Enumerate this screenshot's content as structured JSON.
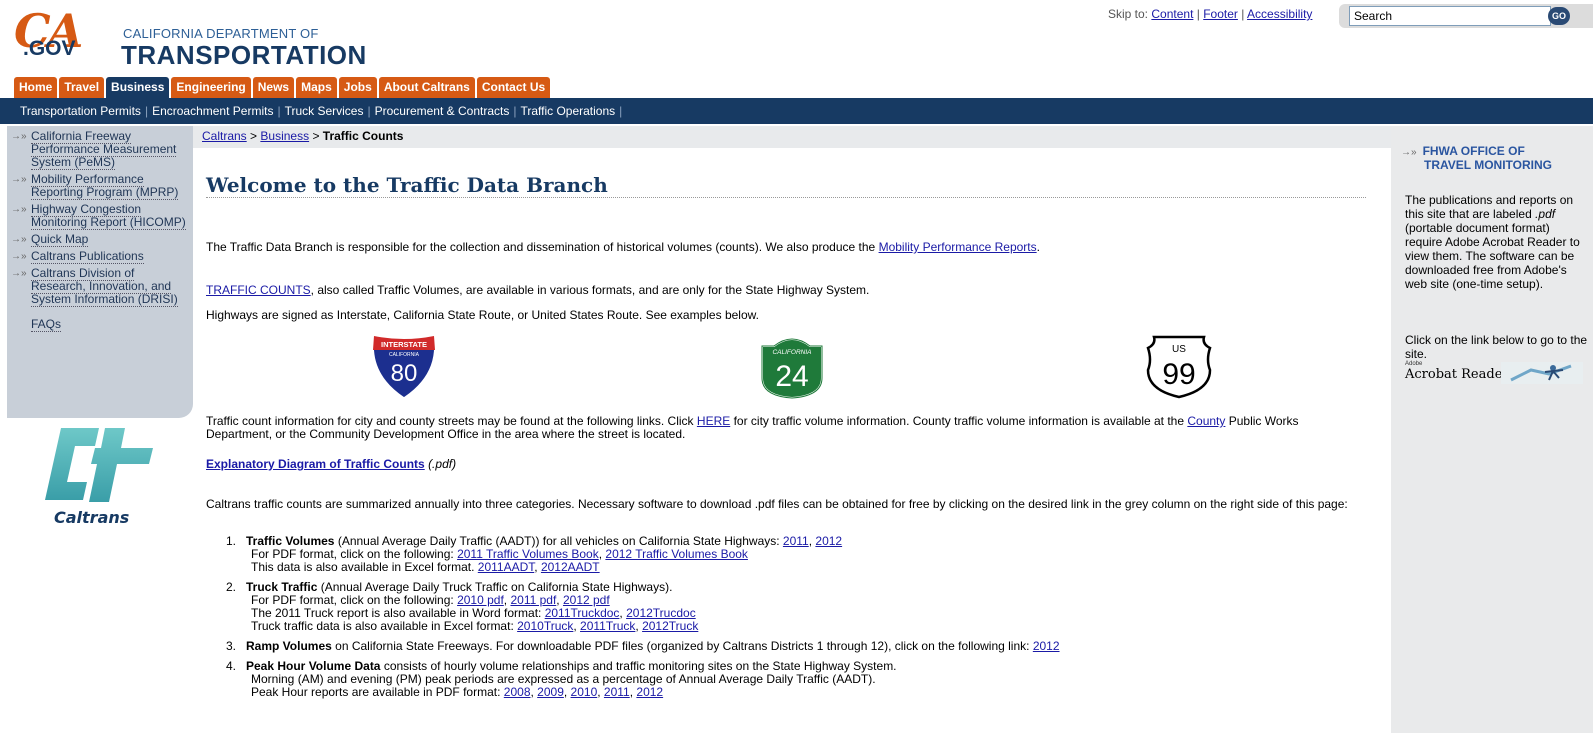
{
  "header": {
    "logo_ca": "CA",
    "logo_gov": ".GOV",
    "logo_dept_sub": "CALIFORNIA DEPARTMENT OF",
    "logo_dept_main": "TRANSPORTATION",
    "skip_to_label": "Skip to:",
    "skip_links": [
      "Content",
      "Footer",
      "Accessibility"
    ],
    "search_value": "Search",
    "search_go_label": "GO"
  },
  "main_nav": {
    "tabs": [
      "Home",
      "Travel",
      "Business",
      "Engineering",
      "News",
      "Maps",
      "Jobs",
      "About Caltrans",
      "Contact Us"
    ],
    "active": "Business",
    "colors": {
      "tab": "#d65a14",
      "active_tab": "#173a63"
    }
  },
  "sub_nav": [
    "Transportation Permits",
    "Encroachment Permits",
    "Truck Services",
    "Procurement & Contracts",
    "Traffic Operations"
  ],
  "left_nav": [
    "California Freeway Performance Measurement System (PeMS)",
    "Mobility Performance Reporting Program (MPRP)",
    "Highway Congestion Monitoring Report (HICOMP)",
    "Quick Map",
    "Caltrans Publications",
    "Caltrans Division of Research, Innovation, and System Information (DRISI)",
    "FAQs"
  ],
  "caltrans_logo_word": "Caltrans",
  "breadcrumb": {
    "items": [
      "Caltrans",
      "Business"
    ],
    "separator": ">",
    "current": "Traffic Counts"
  },
  "main": {
    "title": "Welcome to the Traffic Data Branch",
    "p1_text": "The Traffic Data Branch is responsible for the collection and dissemination of historical volumes (counts). We also produce the",
    "p1_link": "Mobility Performance Reports",
    "p2_link": "TRAFFIC COUNTS",
    "p2_text": ", also called Traffic Volumes, are available in various formats, and are only for the State Highway System.",
    "p3_text": "Highways are signed as Interstate, California State Route, or United States Route. See examples below.",
    "shields": {
      "interstate_label": "INTERSTATE",
      "interstate_state": "CALIFORNIA",
      "interstate_number": "80",
      "state_label": "CALIFORNIA",
      "state_number": "24",
      "us_label": "US",
      "us_number": "99"
    },
    "p4_a": "Traffic count information for city and county streets may be found at the following links. Click",
    "p4_link1": "HERE",
    "p4_b": "for city traffic volume information. County traffic volume information is available at the",
    "p4_link2": "County",
    "p4_c": "Public Works Department, or the Community Development Office in the area where the street is located.",
    "diagram_link": "Explanatory Diagram of Traffic Counts",
    "diagram_suffix": "(.pdf)",
    "p5_text": "Caltrans traffic counts are summarized annually into three categories. Necessary software to download .pdf files can be obtained for free by clicking on the desired link in the grey column on the right side of this page:",
    "list": [
      {
        "num": "1.",
        "title": "Traffic Volumes",
        "desc": "(Annual Average Daily Traffic (AADT)) for all vehicles on California State Highways:",
        "links": [
          "2011",
          "2012"
        ],
        "line2": "For PDF format, click on the following:",
        "line2_links": [
          "2011 Traffic Volumes Book",
          "2012 Traffic Volumes Book"
        ],
        "line3": "This data is also available in Excel format.",
        "line3_links": [
          "2011AADT",
          "2012AADT"
        ]
      },
      {
        "num": "2.",
        "title": "Truck Traffic",
        "desc": "(Annual Average Daily Truck Traffic on California State Highways).",
        "line2": "For PDF format, click on the following:",
        "line2_links": [
          "2010 pdf",
          "2011 pdf",
          "2012 pdf"
        ],
        "line3": "The 2011 Truck report is also available in Word format:",
        "line3_links": [
          "2011Truckdoc",
          "2012Trucdoc"
        ],
        "line4": "Truck traffic data is also available in Excel format:",
        "line4_links": [
          "2010Truck",
          "2011Truck",
          "2012Truck"
        ]
      },
      {
        "num": "3.",
        "title": "Ramp Volumes",
        "desc": "on California State Freeways. For downloadable PDF files (organized by Caltrans Districts 1 through 12), click on the following link:",
        "links": [
          "2012"
        ]
      },
      {
        "num": "4.",
        "title": "Peak Hour Volume Data",
        "desc": "consists of hourly volume relationships and traffic monitoring sites on the State Highway System.",
        "line2": "Morning (AM) and evening (PM) peak periods are expressed as a percentage of Annual Average Daily Traffic (AADT).",
        "line3": "Peak Hour reports are available in PDF format:",
        "line3_links": [
          "2008",
          "2009",
          "2010",
          "2011",
          "2012"
        ]
      }
    ]
  },
  "right": {
    "fhwa_line1": "FHWA OFFICE OF",
    "fhwa_line2": "TRAVEL MONITORING",
    "text1_a": "The publications and reports on this site that are labeled",
    "text1_pdf": ".pdf",
    "text1_b": "(portable document format) require Adobe Acrobat Reader to view them. The software can be downloaded free from Adobe's web site (one-time setup).",
    "text2": "Click on the link below to go to the site.",
    "acrobat_small": "Adobe",
    "acrobat_name": "Acrobat Reader"
  }
}
